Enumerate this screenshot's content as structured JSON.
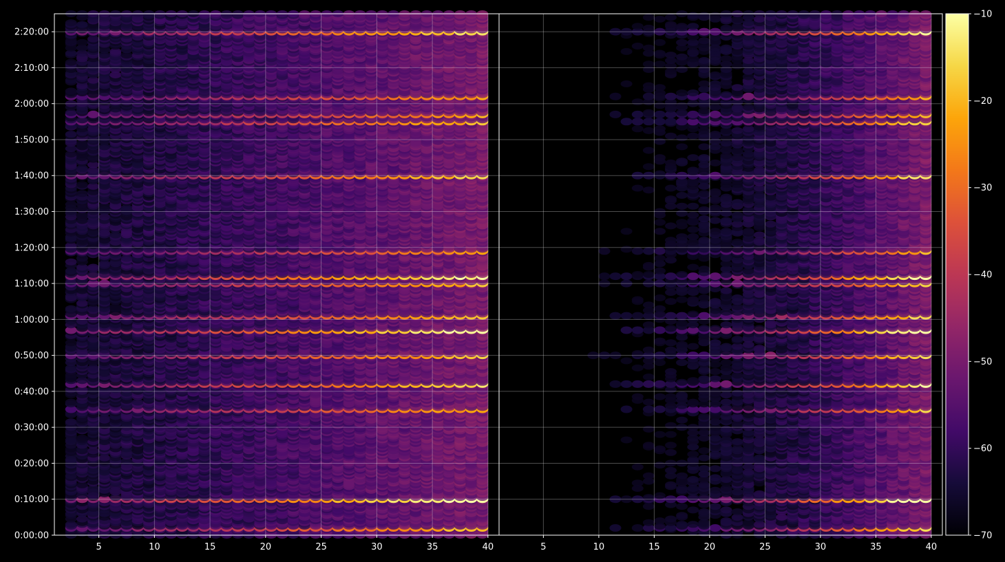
{
  "chart_data": {
    "type": "heatmap",
    "title": "",
    "xlabel": "",
    "ylabel": "",
    "panels": [
      {
        "name": "",
        "x_range": [
          1,
          40
        ],
        "x_ticks": [
          "5",
          "10",
          "15",
          "20",
          "25",
          "30",
          "35",
          "40"
        ]
      },
      {
        "name": "",
        "x_range": [
          1,
          40
        ],
        "x_ticks": [
          "5",
          "10",
          "15",
          "20",
          "25",
          "30",
          "35",
          "40"
        ]
      }
    ],
    "y_range_seconds": [
      0,
      8700
    ],
    "y_tick_labels": [
      "0:00:00",
      "0:10:00",
      "0:20:00",
      "0:30:00",
      "0:40:00",
      "0:50:00",
      "1:00:00",
      "1:10:00",
      "1:20:00",
      "1:30:00",
      "1:40:00",
      "1:50:00",
      "2:00:00",
      "2:10:00",
      "2:20:00"
    ],
    "colorbar": {
      "colormap": "inferno",
      "range": [
        -70,
        -10
      ],
      "tick_labels": [
        "−10",
        "−20",
        "−30",
        "−40",
        "−50",
        "−60",
        "−70"
      ]
    },
    "grid": true,
    "bright_rows_hms": [
      {
        "t": "0:02:00",
        "peak": -24
      },
      {
        "t": "0:10:00",
        "peak": -12
      },
      {
        "t": "0:35:00",
        "peak": -27
      },
      {
        "t": "0:42:00",
        "peak": -20
      },
      {
        "t": "0:50:00",
        "peak": -24
      },
      {
        "t": "0:57:00",
        "peak": -14
      },
      {
        "t": "1:01:00",
        "peak": -24
      },
      {
        "t": "1:10:00",
        "peak": -25
      },
      {
        "t": "1:12:00",
        "peak": -16
      },
      {
        "t": "1:19:00",
        "peak": -30
      },
      {
        "t": "1:40:00",
        "peak": -22
      },
      {
        "t": "1:55:00",
        "peak": -25
      },
      {
        "t": "1:57:00",
        "peak": -28
      },
      {
        "t": "2:02:00",
        "peak": -29
      },
      {
        "t": "2:20:00",
        "peak": -20
      }
    ]
  }
}
